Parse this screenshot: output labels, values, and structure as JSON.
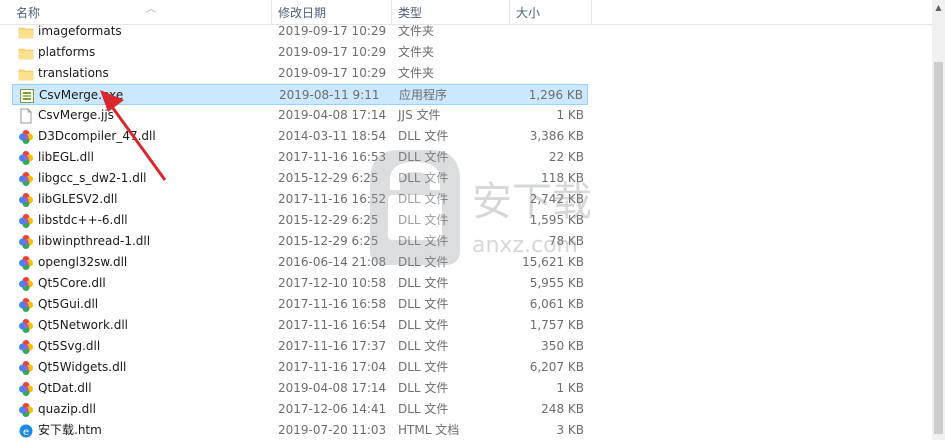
{
  "columns": {
    "name": "名称",
    "date": "修改日期",
    "type": "类型",
    "size": "大小"
  },
  "files": [
    {
      "name": "imageformats",
      "date": "2019-09-17 10:29",
      "type": "文件夹",
      "size": "",
      "icon": "folder"
    },
    {
      "name": "platforms",
      "date": "2019-09-17 10:29",
      "type": "文件夹",
      "size": "",
      "icon": "folder"
    },
    {
      "name": "translations",
      "date": "2019-09-17 10:29",
      "type": "文件夹",
      "size": "",
      "icon": "folder"
    },
    {
      "name": "CsvMerge.exe",
      "date": "2019-08-11 9:11",
      "type": "应用程序",
      "size": "1,296 KB",
      "icon": "exe",
      "selected": true
    },
    {
      "name": "CsvMerge.jjs",
      "date": "2019-04-08 17:14",
      "type": "JJS 文件",
      "size": "1 KB",
      "icon": "file"
    },
    {
      "name": "D3Dcompiler_47.dll",
      "date": "2014-03-11 18:54",
      "type": "DLL 文件",
      "size": "3,386 KB",
      "icon": "dll"
    },
    {
      "name": "libEGL.dll",
      "date": "2017-11-16 16:53",
      "type": "DLL 文件",
      "size": "22 KB",
      "icon": "dll"
    },
    {
      "name": "libgcc_s_dw2-1.dll",
      "date": "2015-12-29 6:25",
      "type": "DLL 文件",
      "size": "118 KB",
      "icon": "dll"
    },
    {
      "name": "libGLESV2.dll",
      "date": "2017-11-16 16:52",
      "type": "DLL 文件",
      "size": "2,742 KB",
      "icon": "dll"
    },
    {
      "name": "libstdc++-6.dll",
      "date": "2015-12-29 6:25",
      "type": "DLL 文件",
      "size": "1,595 KB",
      "icon": "dll"
    },
    {
      "name": "libwinpthread-1.dll",
      "date": "2015-12-29 6:25",
      "type": "DLL 文件",
      "size": "78 KB",
      "icon": "dll"
    },
    {
      "name": "opengl32sw.dll",
      "date": "2016-06-14 21:08",
      "type": "DLL 文件",
      "size": "15,621 KB",
      "icon": "dll"
    },
    {
      "name": "Qt5Core.dll",
      "date": "2017-12-10 10:58",
      "type": "DLL 文件",
      "size": "5,955 KB",
      "icon": "dll"
    },
    {
      "name": "Qt5Gui.dll",
      "date": "2017-11-16 16:58",
      "type": "DLL 文件",
      "size": "6,061 KB",
      "icon": "dll"
    },
    {
      "name": "Qt5Network.dll",
      "date": "2017-11-16 16:54",
      "type": "DLL 文件",
      "size": "1,757 KB",
      "icon": "dll"
    },
    {
      "name": "Qt5Svg.dll",
      "date": "2017-11-16 17:37",
      "type": "DLL 文件",
      "size": "350 KB",
      "icon": "dll"
    },
    {
      "name": "Qt5Widgets.dll",
      "date": "2017-11-16 17:04",
      "type": "DLL 文件",
      "size": "6,207 KB",
      "icon": "dll"
    },
    {
      "name": "QtDat.dll",
      "date": "2019-04-08 17:14",
      "type": "DLL 文件",
      "size": "1 KB",
      "icon": "dll"
    },
    {
      "name": "quazip.dll",
      "date": "2017-12-06 14:41",
      "type": "DLL 文件",
      "size": "248 KB",
      "icon": "dll"
    },
    {
      "name": "安下载.htm",
      "date": "2019-07-20 11:03",
      "type": "HTML 文档",
      "size": "3 KB",
      "icon": "html"
    }
  ],
  "watermark": {
    "text": "安下载",
    "url": "anxz.com"
  },
  "colors": {
    "selection": "#cce8ff",
    "selection_border": "#99d1ff",
    "arrow": "#d9272e",
    "folder": "#f8d775"
  }
}
